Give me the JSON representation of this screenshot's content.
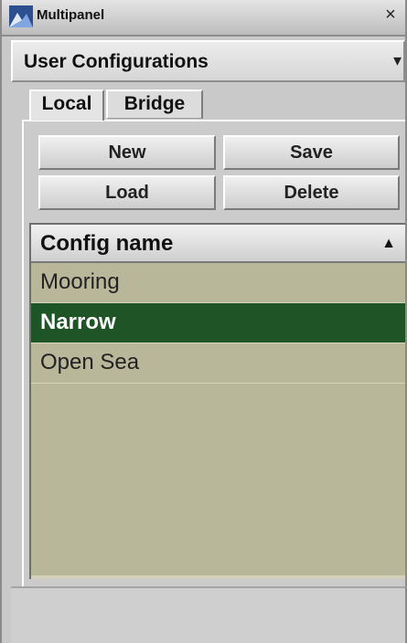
{
  "window": {
    "title": "Multipanel",
    "close_glyph": "×",
    "icon": "multipanel-app-icon"
  },
  "dropdown": {
    "label": "User Configurations",
    "arrow_glyph": "▾"
  },
  "tabs": [
    {
      "label": "Local",
      "active": true
    },
    {
      "label": "Bridge",
      "active": false
    }
  ],
  "buttons": {
    "new": "New",
    "save": "Save",
    "load": "Load",
    "delete": "Delete"
  },
  "list": {
    "column_header": "Config name",
    "sort_glyph": "▲",
    "rows": [
      {
        "label": "Mooring",
        "selected": false
      },
      {
        "label": "Narrow",
        "selected": true
      },
      {
        "label": "Open Sea",
        "selected": false
      }
    ]
  },
  "colors": {
    "list_background": "#b9b79a",
    "selection": "#1f5526"
  }
}
